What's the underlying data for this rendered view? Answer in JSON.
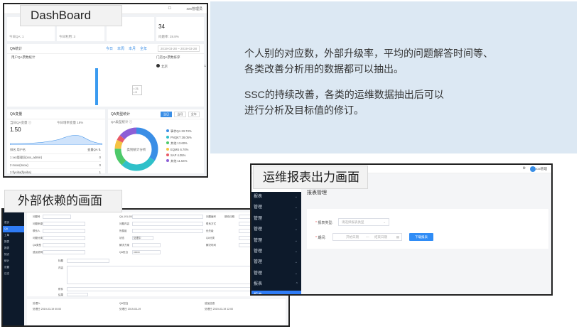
{
  "labels": {
    "dashboard": "DashBoard",
    "external": "外部依赖的画面",
    "report": "运维报表出力画面"
  },
  "description": {
    "line1": "个人别的对应数，外部升级率，平均的问题解答时间等、",
    "line2": "各类改善分析用的数据都可以抽出。",
    "line3": "SSC的持续改善，各类的运维数据抽出后可以",
    "line4": "进行分析及目标值的修订。"
  },
  "dashboard": {
    "topbar": {
      "bell": "☐",
      "user": "xxx管理员"
    },
    "stats": [
      {
        "value": "",
        "foot": "今日QA: 1"
      },
      {
        "value": "",
        "foot": "今日利用: 3"
      },
      {
        "value": "",
        "foot": ""
      },
      {
        "value": "34",
        "foot": "问题率: 28.8%"
      }
    ],
    "qa": {
      "title": "QA统计",
      "tabs": [
        "今日",
        "本周",
        "本月",
        "全年"
      ],
      "range": "2019-03-28 ~ 2019-03-28",
      "chart_subtitle": "用户QA票数统计",
      "tooltip_line1": "• 21",
      "tooltip_line2": "• 0",
      "rank_title": "门店QA票数排序",
      "rank_item": "北京",
      "rank_value": "1"
    },
    "left_card": {
      "title": "QA变量",
      "kv1": "当日QA变量 ⓘ",
      "kv2": "今日增率变量  18%",
      "big": "1.50",
      "table_header": [
        "排名  用户名",
        "变量QA  ⇅"
      ],
      "rows": [
        [
          "1   xxx管理员(xxx_admin)",
          "0"
        ],
        [
          "2   mxxx(mxxx)",
          "0"
        ],
        [
          "3   flyxiba(flyxiba)",
          "1"
        ]
      ]
    },
    "right_card": {
      "title": "QA类型统计",
      "tabs": [
        "当日",
        "当月",
        "全年"
      ],
      "sub": "QA类型统计 ⓘ",
      "center": "类别统计分析",
      "legend": [
        {
          "name": "事件QA  33.73%",
          "color": "#3a8ee6"
        },
        {
          "name": "PNQKT  28.05%",
          "color": "#2fc0c9"
        },
        {
          "name": "其他  13.60%",
          "color": "#4dc96a"
        },
        {
          "name": "EQMS  6.70%",
          "color": "#f5c342"
        },
        {
          "name": "SAP  4.05%",
          "color": "#e85a66"
        },
        {
          "name": "其他  11.54%",
          "color": "#8c5fd6"
        }
      ]
    }
  },
  "external": {
    "sidebar": [
      "首页",
      "QA",
      "工单",
      "报表",
      "报表",
      "知识",
      "统计",
      "设置",
      "日志"
    ],
    "active_index": 1,
    "fields_row1": [
      "问题号",
      "QA-191-0005",
      "问题编号",
      "ERO-191-0001",
      "期待日期",
      "2019-03-18"
    ],
    "fields_row2": [
      "问题来源",
      "",
      "问题内容",
      "ERO",
      "联系方式",
      ""
    ],
    "fields_row3": [
      "联系人",
      "",
      "所属组",
      "",
      "优先级",
      "2019-03-15"
    ],
    "fields_row4": [
      "问题分类",
      "",
      "状态",
      "处理中",
      "QA分类",
      ""
    ],
    "fields_row5": [
      "QA类型",
      "",
      "解决方案",
      "",
      "解决时间",
      ""
    ],
    "fields_row6": [
      "追加说明",
      "",
      "QA担当",
      "xxxxx",
      "",
      ""
    ],
    "detail_labels": [
      "标题",
      "内容",
      "附件",
      "结果"
    ],
    "bottom": [
      "处理人",
      "处理日 2019-03-19 00:00",
      "QA担当",
      "处理日 2019-03-19",
      "追加信息",
      "处理日 2019-03-19 12:00"
    ]
  },
  "report": {
    "topbar": {
      "gear": "⚙",
      "user": "xxx管理"
    },
    "sidebar": [
      {
        "label": "报表",
        "chev": "⌄"
      },
      {
        "label": "管理",
        "chev": "⌄"
      },
      {
        "label": "管理",
        "chev": "⌄"
      },
      {
        "label": "管理",
        "chev": "⌄"
      },
      {
        "label": "管理",
        "chev": "⌄"
      },
      {
        "label": "管理",
        "chev": "⌄"
      },
      {
        "label": "管理",
        "chev": "⌄"
      },
      {
        "label": "管理",
        "chev": "⌄"
      },
      {
        "label": "报表",
        "chev": "^"
      },
      {
        "label": "报表",
        "chev": ""
      }
    ],
    "active_index": 9,
    "title": "报表管理",
    "type_label": "报表类型:",
    "type_placeholder": "请选择报表类型",
    "date_label": "期间:",
    "date_start": "开始日期",
    "date_sep": "—",
    "date_end": "结束日期",
    "download": "下载报表"
  }
}
